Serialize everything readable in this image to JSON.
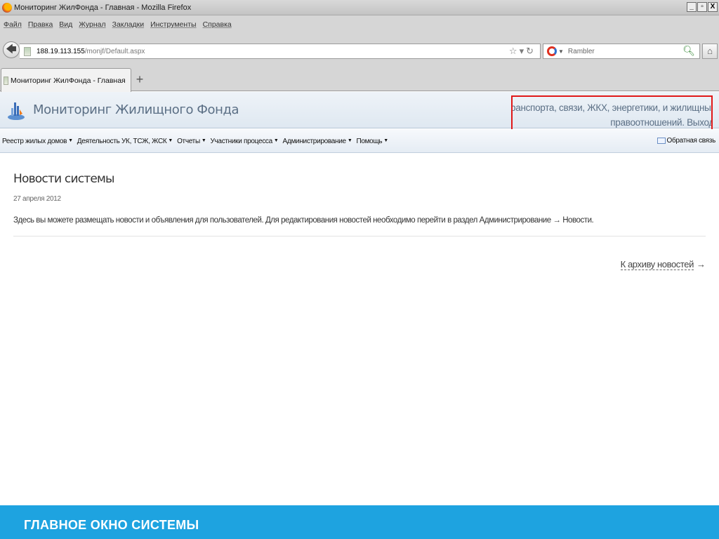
{
  "window": {
    "title": "Мониторинг ЖилФонда - Главная - Mozilla Firefox",
    "controls": {
      "minimize": "_",
      "maximize": "ð",
      "close": "X"
    }
  },
  "browser_menu": [
    {
      "label": "Файл"
    },
    {
      "label": "Правка"
    },
    {
      "label": "Вид"
    },
    {
      "label": "Журнал"
    },
    {
      "label": "Закладки"
    },
    {
      "label": "Инструменты"
    },
    {
      "label": "Справка"
    }
  ],
  "address_bar": {
    "host": "188.19.113.155",
    "path": "/monjf/Default.aspx"
  },
  "search_bar": {
    "engine": "Rambler"
  },
  "tabs": [
    {
      "label": "Мониторинг ЖилФонда - Главная"
    }
  ],
  "new_tab_label": "+",
  "app": {
    "title": "Мониторинг Жилищного Фонда",
    "user_department": "Отдел транспорта, связи, ЖКХ, энергетики, и жилищных",
    "user_department_cont": "правоотношений",
    "logout_label": "Выход",
    "highlight_color": "#e01818",
    "nav": [
      {
        "label": "Реестр жилых домов"
      },
      {
        "label": "Деятельность УК, ТСЖ, ЖСК"
      },
      {
        "label": "Отчеты"
      },
      {
        "label": "Участники процесса"
      },
      {
        "label": "Администрирование"
      },
      {
        "label": "Помощь"
      }
    ],
    "feedback_label": "Обратная связь"
  },
  "news": {
    "heading": "Новости системы",
    "date": "27 апреля 2012",
    "text": "Здесь вы можете размещать новости и объявления для пользователей. Для редактирования новостей необходимо перейти в раздел Администрирование → Новости.",
    "archive_link": "К архиву новостей",
    "archive_arrow": "→"
  },
  "caption": {
    "text": "ГЛАВНОЕ ОКНО СИСТЕМЫ",
    "background": "#1ea3e0"
  }
}
